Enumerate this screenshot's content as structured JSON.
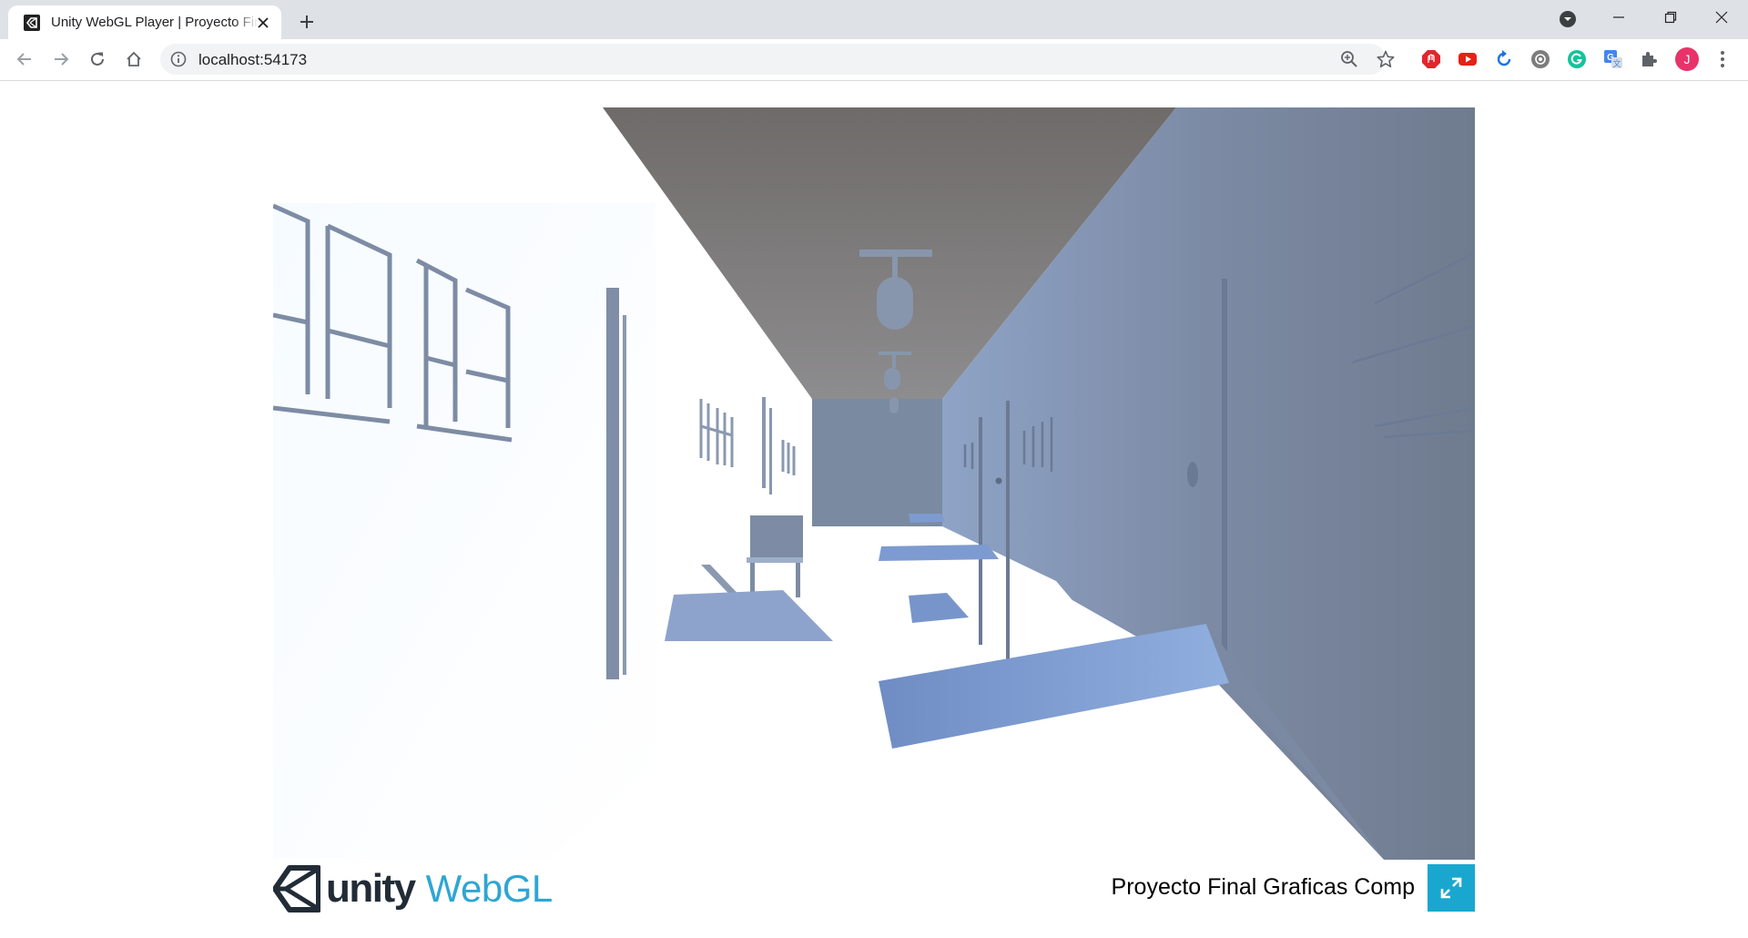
{
  "browser": {
    "tab": {
      "title": "Unity WebGL Player | Proyecto Final Graficas Comp",
      "favicon": "unity-icon"
    },
    "window_controls": [
      "minimize-icon",
      "restore-icon",
      "close-icon"
    ],
    "address_bar": {
      "url": "localhost:54173"
    },
    "extensions": [
      "adblock-icon",
      "youtube-icon",
      "sync-icon",
      "camera-extension-icon",
      "grammarly-icon",
      "translate-icon",
      "puzzle-icon"
    ],
    "profile": {
      "initial": "J",
      "color": "#e8336a"
    }
  },
  "player": {
    "scene": "3d-corridor-scene",
    "footer": {
      "logo_unity": "unity",
      "logo_webgl": "WebGL",
      "title": "Proyecto Final Graficas Comp"
    },
    "accent_color": "#1aa7cf"
  }
}
